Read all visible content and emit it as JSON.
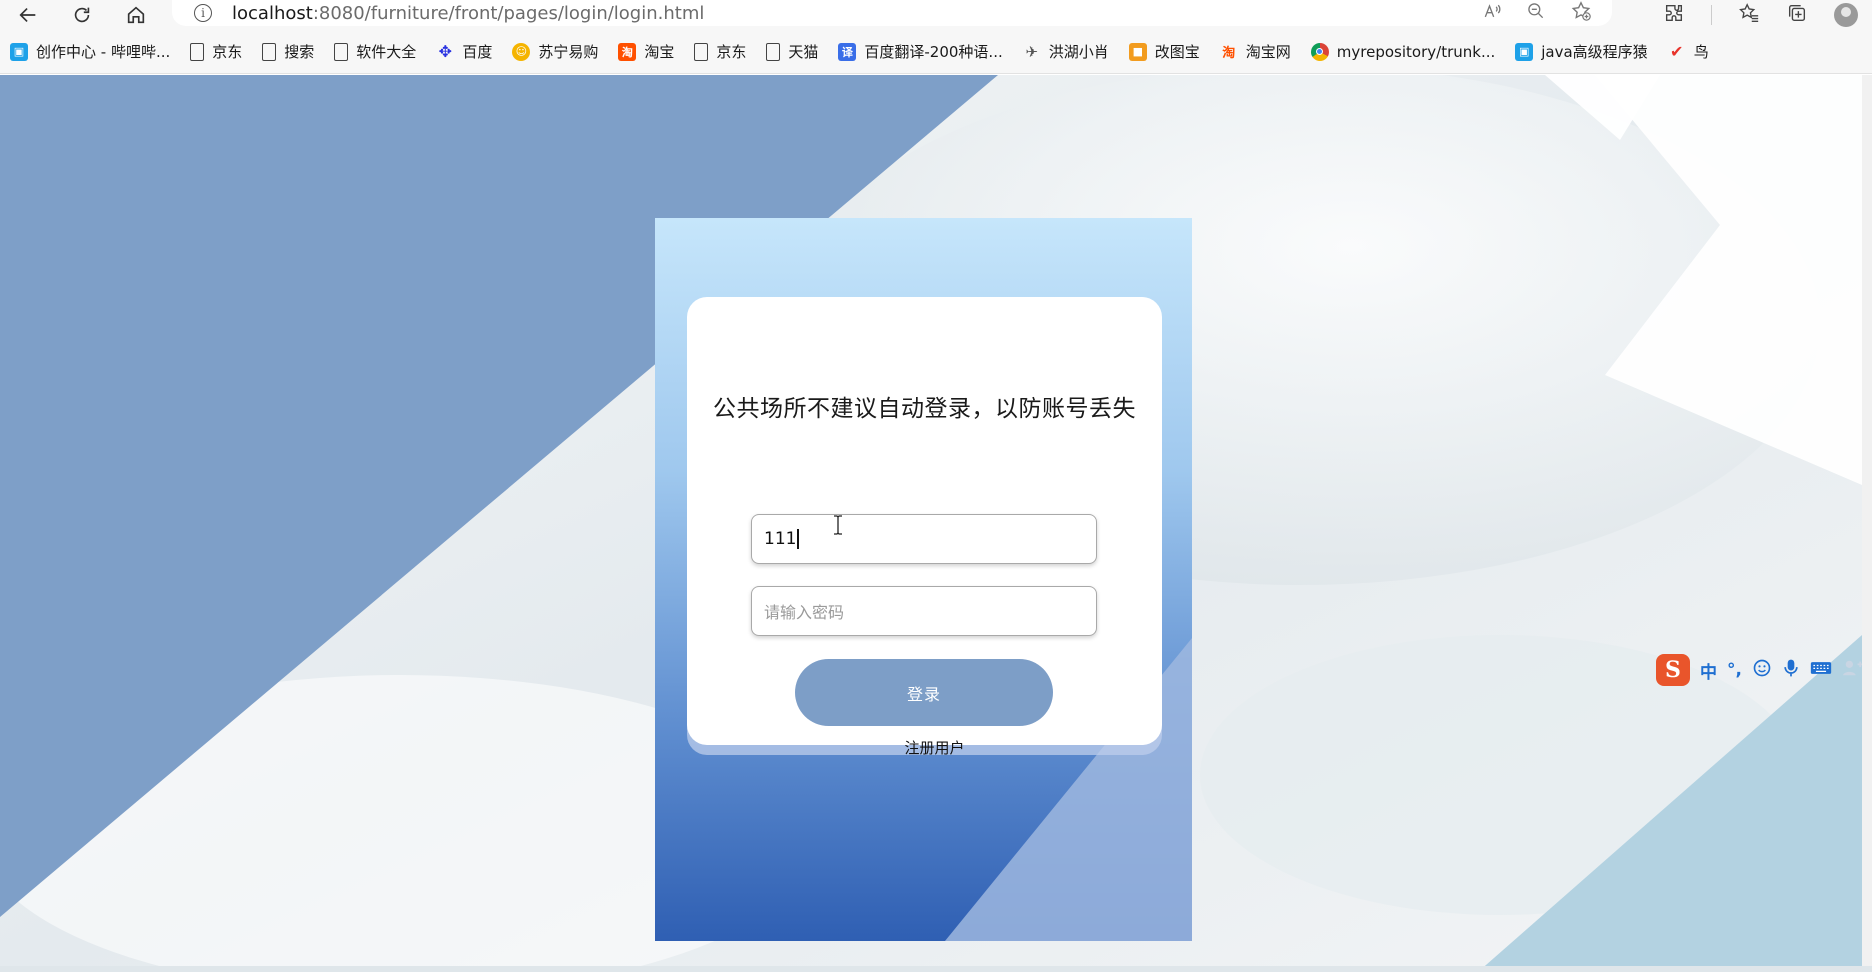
{
  "browser": {
    "url_host": "localhost",
    "url_path": ":8080/furniture/front/pages/login/login.html"
  },
  "bookmarks": [
    {
      "label": "创作中心 - 哔哩哔...",
      "icon": "bilibili-icon",
      "color": "#1ea1e8"
    },
    {
      "label": "京东",
      "icon": "page-icon"
    },
    {
      "label": "搜索",
      "icon": "page-icon"
    },
    {
      "label": "软件大全",
      "icon": "page-icon"
    },
    {
      "label": "百度",
      "icon": "baidu-paw-icon",
      "color": "#2932e1"
    },
    {
      "label": "苏宁易购",
      "icon": "suning-icon",
      "color": "#f5b400"
    },
    {
      "label": "淘宝",
      "icon": "taobao-icon",
      "color": "#ff5000"
    },
    {
      "label": "京东",
      "icon": "page-icon"
    },
    {
      "label": "天猫",
      "icon": "page-icon"
    },
    {
      "label": "百度翻译-200种语...",
      "icon": "baidu-translate-icon",
      "color": "#3a6ee8"
    },
    {
      "label": "洪湖小肖",
      "icon": "bird-icon",
      "color": "#555555"
    },
    {
      "label": "改图宝",
      "icon": "gaitubao-icon",
      "color": "#f29c1f"
    },
    {
      "label": "淘宝网",
      "icon": "taobao-icon",
      "color": "#ff5000"
    },
    {
      "label": "myrepository/trunk...",
      "icon": "chrome-icon",
      "color": "#db4437"
    },
    {
      "label": "java高级程序猿",
      "icon": "bilibili-icon",
      "color": "#1ea1e8"
    },
    {
      "label": "鸟",
      "icon": "bird-red-icon",
      "color": "#e8332b"
    }
  ],
  "login": {
    "title": "公共场所不建议自动登录，以防账号丢失",
    "username_value": "111",
    "password_placeholder": "请输入密码",
    "login_button": "登录",
    "register_link": "注册用户"
  },
  "ime": {
    "logo": "S",
    "mode": "中",
    "punct": "°,"
  },
  "colors": {
    "page_bg_blue": "#7e9fc8",
    "panel_top": "#c6e6fb",
    "panel_bottom": "#2f5fb3",
    "login_button": "#7d9ec7"
  }
}
